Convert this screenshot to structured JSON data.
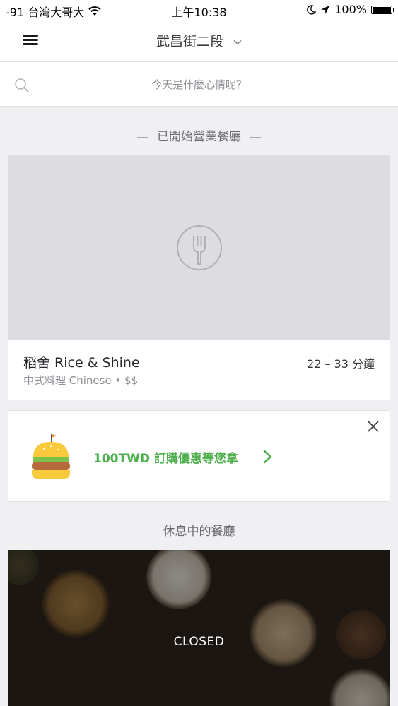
{
  "status_bar": {
    "carrier": "-91 台湾大哥大",
    "time": "上午10:38",
    "battery": "100%",
    "battery_level": 1.0
  },
  "nav": {
    "location": "武昌街二段",
    "menu_icon": "hamburger-menu-icon",
    "dropdown_icon": "chevron-down-icon"
  },
  "search": {
    "placeholder": "今天是什麼心情呢？",
    "icon": "search-icon"
  },
  "open_section": {
    "title": "已開始營業餐廳",
    "restaurants": [
      {
        "name": "稻舍 Rice & Shine",
        "category": "中式料理 Chinese • $$",
        "eta": "22 – 33 分鐘",
        "image_placeholder_icon": "fork-icon"
      }
    ]
  },
  "promo": {
    "text": "100TWD 訂購優惠等您拿",
    "icon": "burger-icon",
    "accent_color": "#4cae4c"
  },
  "closed_section": {
    "title": "休息中的餐廳",
    "restaurants": [
      {
        "label": "CLOSED"
      }
    ]
  },
  "colors": {
    "background": "#f0f0f3",
    "card": "#ffffff",
    "accent_green": "#4cae4c"
  }
}
